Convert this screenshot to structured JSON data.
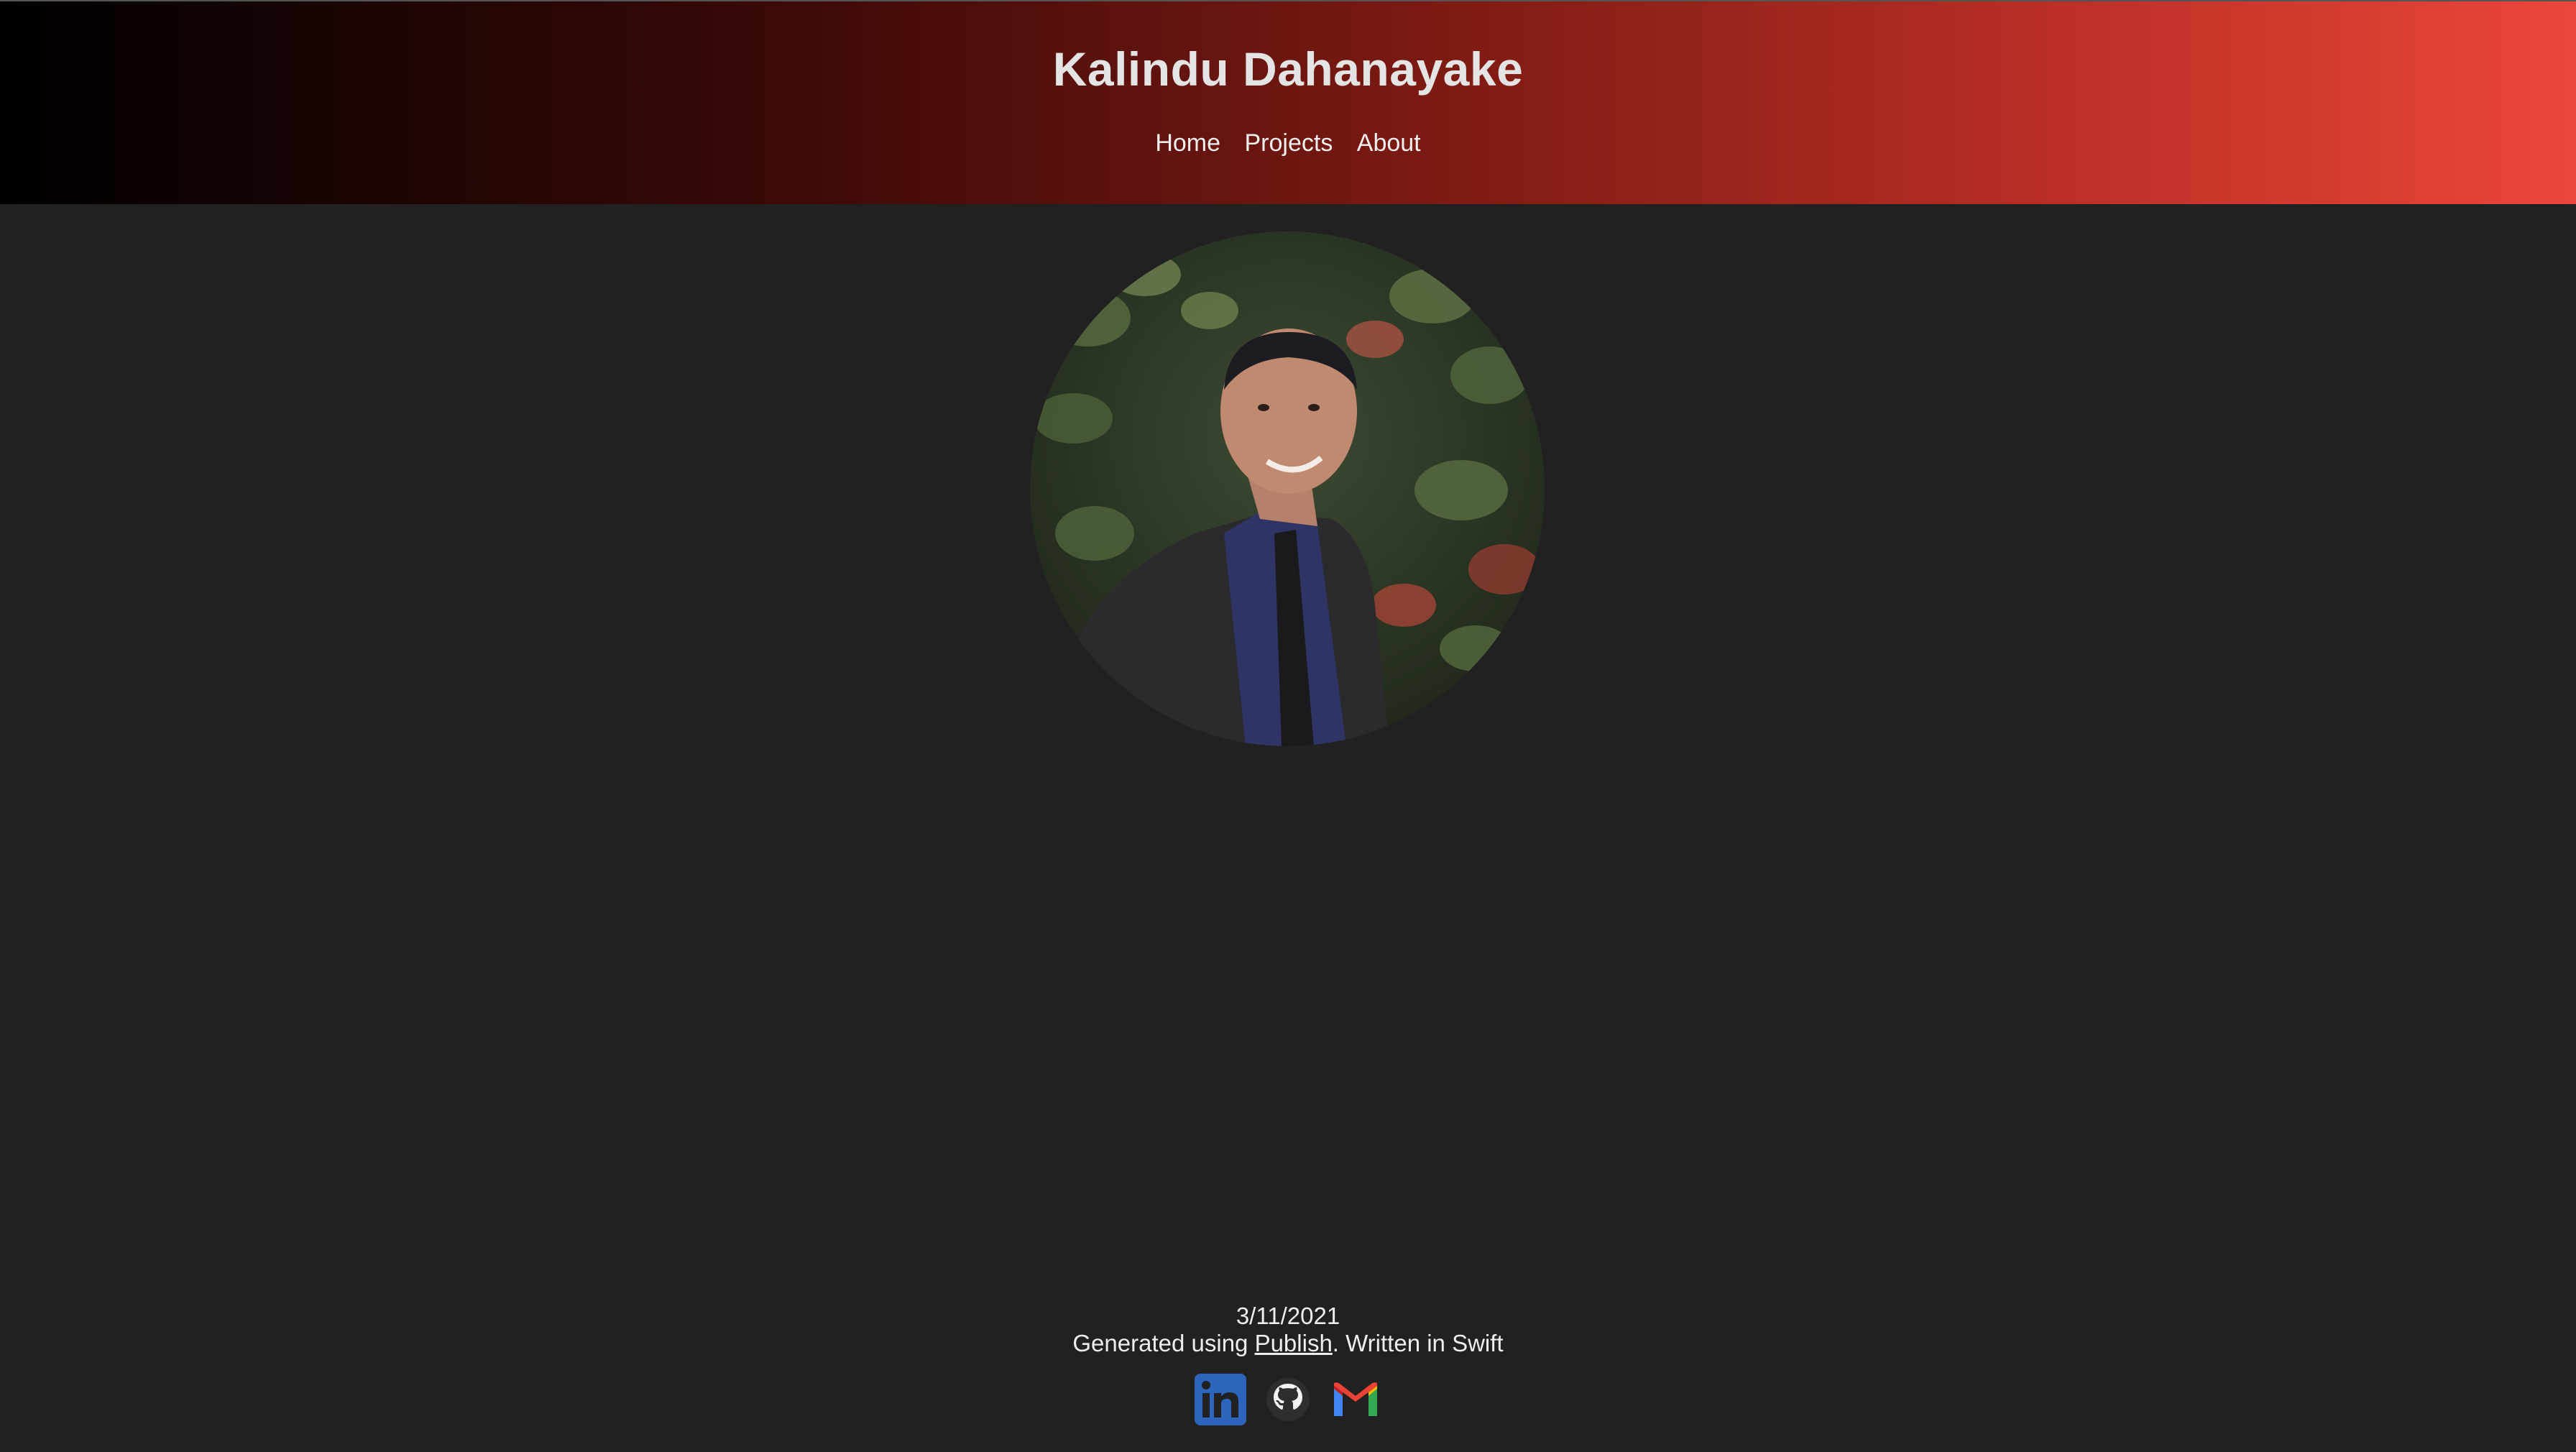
{
  "header": {
    "title": "Kalindu Dahanayake",
    "nav": [
      {
        "label": "Home"
      },
      {
        "label": "Projects"
      },
      {
        "label": "About"
      }
    ]
  },
  "profile": {
    "photo_icon": "profile-photo"
  },
  "footer": {
    "date": "3/11/2021",
    "generated_prefix": "Generated using ",
    "publish_link": "Publish",
    "generated_suffix": ". Written in Swift",
    "socials": [
      {
        "name": "linkedin-icon",
        "color": "#2d64bc"
      },
      {
        "name": "github-icon",
        "color": "#f2f2f2"
      },
      {
        "name": "gmail-icon",
        "color": "#ea4335"
      }
    ]
  },
  "colors": {
    "background": "#212121",
    "header_gradient_start": "#000000",
    "header_gradient_end": "#ec463a"
  }
}
